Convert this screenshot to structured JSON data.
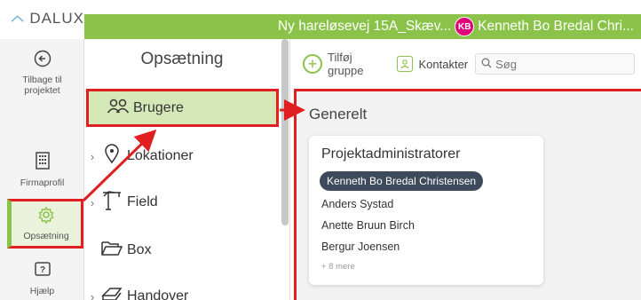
{
  "brand": {
    "logo_text": "DALUX"
  },
  "header": {
    "project": "Ny hareløsevej 15A_Skæv...",
    "avatar_initials": "KB",
    "user": "Kenneth Bo Bredal Chri..."
  },
  "rail": {
    "back_label": "Tilbage til projektet",
    "firma_label": "Firmaprofil",
    "setup_label": "Opsætning",
    "help_label": "Hjælp"
  },
  "menu": {
    "title": "Opsætning",
    "items": [
      {
        "label": "Brugere"
      },
      {
        "label": "Lokationer"
      },
      {
        "label": "Field"
      },
      {
        "label": "Box"
      },
      {
        "label": "Handover"
      }
    ]
  },
  "toolbar": {
    "add_group_line1": "Tilføj",
    "add_group_line2": "gruppe",
    "contacts_label": "Kontakter",
    "search_placeholder": "Søg"
  },
  "content": {
    "section_title": "Generelt",
    "card": {
      "title": "Projektadministratorer",
      "highlighted_user": "Kenneth Bo Bredal Christensen",
      "users": [
        "Anders Systad",
        "Anette Bruun Birch",
        "Bergur Joensen"
      ],
      "more": "+ 8 mere"
    }
  },
  "colors": {
    "accent": "#8bc34a",
    "highlight": "#e02020",
    "chip": "#3d4a5c"
  }
}
